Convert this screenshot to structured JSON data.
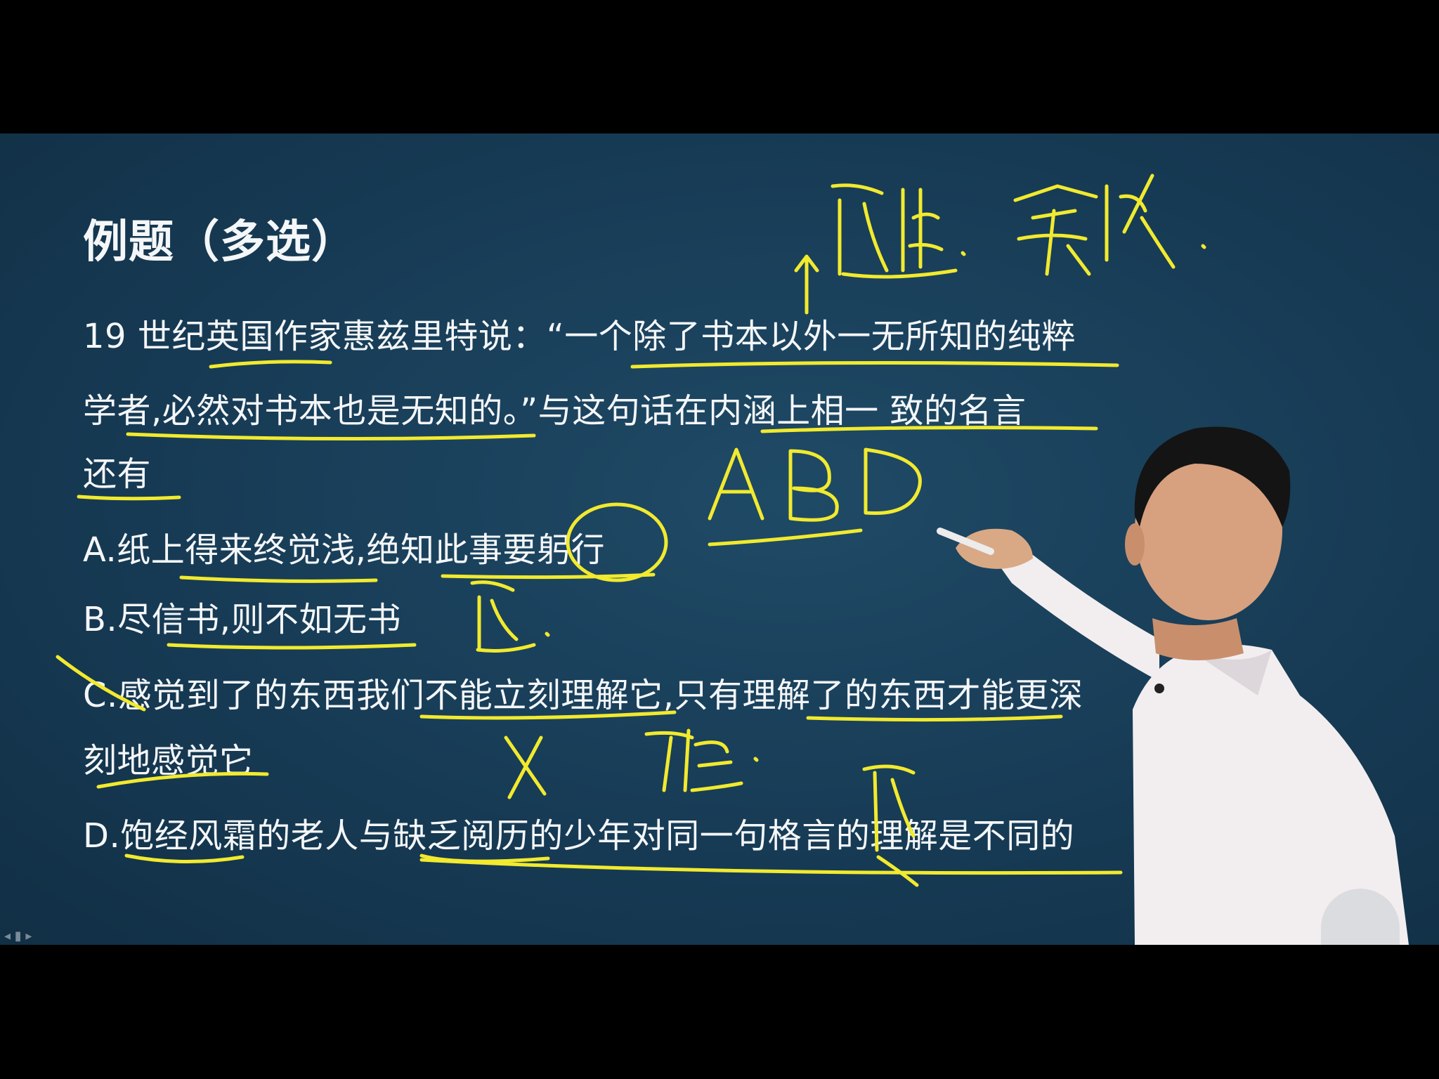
{
  "slide": {
    "title": "例题（多选）",
    "question_line1": "19 世纪英国作家惠兹里特说：“一个除了书本以外一无所知的纯粹",
    "question_line2": "学者,必然对书本也是无知的。”与这句话在内涵上相一 致的名言",
    "question_line3": "还有",
    "option_a": "A.纸上得来终觉浅,绝知此事要躬行",
    "option_b": "B.尽信书,则不如无书",
    "option_c_line1": "C.感觉到了的东西我们不能立刻理解它,只有理解了的东西才能更深",
    "option_c_line2": "刻地感觉它",
    "option_d": "D.饱经风霜的老人与缺乏阅历的少年对同一句格言的理解是不同的"
  },
  "colors": {
    "board": "#173b55",
    "text": "#f4f6f8",
    "ink": "#f1ea2e",
    "shirt": "#f2eef0"
  },
  "icons": {
    "annotation": "handwritten-annotation",
    "presenter": "presenter-figure",
    "corner_logo": "corner-logo-icon"
  }
}
